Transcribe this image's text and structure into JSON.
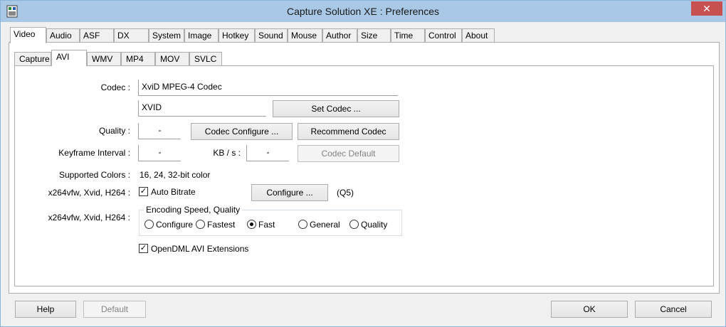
{
  "window": {
    "title": "Capture Solution XE : Preferences",
    "close_glyph": "✕"
  },
  "main_tabs": [
    "Video",
    "Audio",
    "ASF",
    "DX",
    "System",
    "Image",
    "Hotkey",
    "Sound",
    "Mouse",
    "Author",
    "Size",
    "Time",
    "Control",
    "About"
  ],
  "sub_tabs": [
    "Capture",
    "AVI",
    "WMV",
    "MP4",
    "MOV",
    "SVLC"
  ],
  "form": {
    "codec_label": "Codec :",
    "codec_value": "XviD MPEG-4 Codec",
    "fourcc_value": "XVID",
    "set_codec_button": "Set Codec ...",
    "quality_label": "Quality :",
    "quality_value": "-",
    "codec_configure_button": "Codec Configure ...",
    "recommend_codec_button": "Recommend Codec",
    "keyframe_label": "Keyframe Interval :",
    "keyframe_value": "-",
    "kbs_label": "KB / s :",
    "kbs_value": "-",
    "codec_default_button": "Codec Default",
    "supported_colors_label": "Supported Colors :",
    "supported_colors_value": "16, 24, 32-bit color",
    "x264_label_1": "x264vfw, Xvid, H264 :",
    "auto_bitrate_label": "Auto Bitrate",
    "auto_bitrate_checked": true,
    "configure_button": "Configure ...",
    "q5_text": "(Q5)",
    "x264_label_2": "x264vfw, Xvid, H264 :",
    "encoding_group_title": "Encoding Speed, Quality",
    "encoding_options": [
      "Configure",
      "Fastest",
      "Fast",
      "General",
      "Quality"
    ],
    "encoding_selected": "Fast",
    "opendml_label": "OpenDML AVI Extensions",
    "opendml_checked": true,
    "check_glyph": "✓"
  },
  "footer": {
    "help": "Help",
    "default": "Default",
    "ok": "OK",
    "cancel": "Cancel"
  },
  "colors": {
    "titlebar": "#a9c8e6",
    "close": "#c75050"
  }
}
